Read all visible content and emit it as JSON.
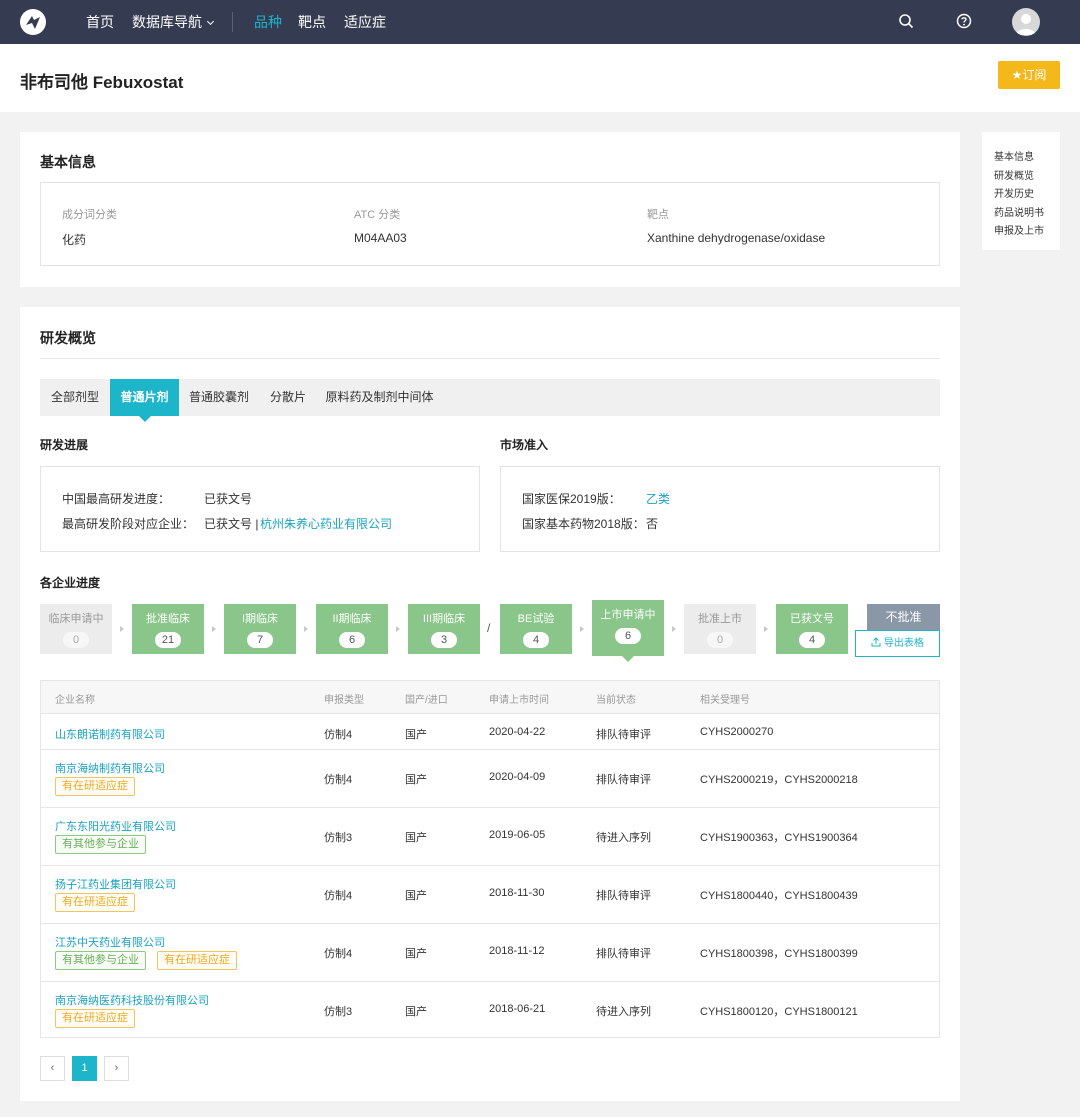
{
  "nav": {
    "items": [
      {
        "label": "首页"
      },
      {
        "label": "数据库导航"
      },
      {
        "label": "品种"
      },
      {
        "label": "靶点"
      },
      {
        "label": "适应症"
      }
    ],
    "accent": "#1cb5c9"
  },
  "page": {
    "title": "非布司他 Febuxostat",
    "subscribe_label": "订阅"
  },
  "side_nav": [
    "基本信息",
    "研发概览",
    "开发历史",
    "药品说明书",
    "申报及上市"
  ],
  "basic_info": {
    "title": "基本信息",
    "fields": [
      {
        "label": "成分词分类",
        "value": "化药"
      },
      {
        "label": "ATC 分类",
        "value": "M04AA03"
      },
      {
        "label": "靶点",
        "value": "Xanthine dehydrogenase/oxidase"
      }
    ]
  },
  "overview": {
    "title": "研发概览",
    "tabs": [
      "全部剂型",
      "普通片剂",
      "普通胶囊剂",
      "分散片",
      "原料药及制剂中间体"
    ],
    "active_tab": "普通片剂",
    "progress": {
      "title": "研发进展",
      "rows": [
        {
          "label": "中国最高研发进度：",
          "value": "已获文号"
        },
        {
          "label": "最高研发阶段对应企业：",
          "value": "已获文号 | ",
          "link": "杭州朱养心药业有限公司"
        }
      ]
    },
    "market": {
      "title": "市场准入",
      "rows": [
        {
          "label": "国家医保2019版：",
          "value": "乙类"
        },
        {
          "label": "国家基本药物2018版：",
          "value": "否"
        }
      ]
    }
  },
  "pipeline": {
    "title": "各企业进度",
    "stages": [
      {
        "name": "临床申请中",
        "count": "0"
      },
      {
        "name": "批准临床",
        "count": "21"
      },
      {
        "name": "I期临床",
        "count": "7"
      },
      {
        "name": "II期临床",
        "count": "6"
      },
      {
        "name": "III期临床",
        "count": "3"
      },
      {
        "name": "BE试验",
        "count": "4"
      },
      {
        "name": "上市申请中",
        "count": "6"
      },
      {
        "name": "批准上市",
        "count": "0"
      },
      {
        "name": "已获文号",
        "count": "4"
      }
    ],
    "separator": "/",
    "reject_label": "不批准",
    "export_label": "导出表格"
  },
  "table": {
    "headers": [
      "企业名称",
      "申报类型",
      "国产/进口",
      "申请上市时间",
      "当前状态",
      "相关受理号"
    ],
    "rows": [
      {
        "company": "山东朗诺制药有限公司",
        "tags": [],
        "type": "仿制4",
        "origin": "国产",
        "date": "2020-04-22",
        "status": "排队待审评",
        "refs": "CYHS2000270"
      },
      {
        "company": "南京海纳制药有限公司",
        "tags": [
          {
            "text": "有在研适应症",
            "color": "yellow"
          }
        ],
        "type": "仿制4",
        "origin": "国产",
        "date": "2020-04-09",
        "status": "排队待审评",
        "refs": "CYHS2000219，CYHS2000218"
      },
      {
        "company": "广东东阳光药业有限公司",
        "tags": [
          {
            "text": "有其他参与企业",
            "color": "green"
          }
        ],
        "type": "仿制3",
        "origin": "国产",
        "date": "2019-06-05",
        "status": "待进入序列",
        "refs": "CYHS1900363，CYHS1900364"
      },
      {
        "company": "扬子江药业集团有限公司",
        "tags": [
          {
            "text": "有在研适应症",
            "color": "yellow"
          }
        ],
        "type": "仿制4",
        "origin": "国产",
        "date": "2018-11-30",
        "status": "排队待审评",
        "refs": "CYHS1800440，CYHS1800439"
      },
      {
        "company": "江苏中天药业有限公司",
        "tags": [
          {
            "text": "有其他参与企业",
            "color": "green"
          },
          {
            "text": "有在研适应症",
            "color": "yellow"
          }
        ],
        "type": "仿制4",
        "origin": "国产",
        "date": "2018-11-12",
        "status": "排队待审评",
        "refs": "CYHS1800398，CYHS1800399"
      },
      {
        "company": "南京海纳医药科技股份有限公司",
        "tags": [
          {
            "text": "有在研适应症",
            "color": "yellow"
          }
        ],
        "type": "仿制3",
        "origin": "国产",
        "date": "2018-06-21",
        "status": "待进入序列",
        "refs": "CYHS1800120，CYHS1800121"
      }
    ]
  },
  "pagination": {
    "prev": "‹",
    "current": "1",
    "next": "›"
  }
}
